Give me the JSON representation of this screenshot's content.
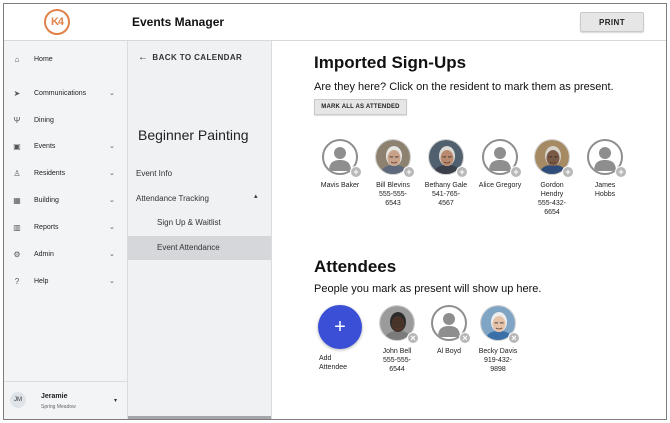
{
  "app": {
    "logo_text": "K4",
    "title": "Events Manager",
    "print_label": "PRINT"
  },
  "sidebar": {
    "items": [
      {
        "label": "Home",
        "icon": "home-icon",
        "glyph": "⌂",
        "has_chevron": false
      },
      {
        "label": "Communications",
        "icon": "send-icon",
        "glyph": "➤",
        "has_chevron": true
      },
      {
        "label": "Dining",
        "icon": "utensils-icon",
        "glyph": "Ψ",
        "has_chevron": false
      },
      {
        "label": "Events",
        "icon": "calendar-icon",
        "glyph": "▣",
        "has_chevron": true
      },
      {
        "label": "Residents",
        "icon": "person-icon",
        "glyph": "♙",
        "has_chevron": true
      },
      {
        "label": "Building",
        "icon": "building-icon",
        "glyph": "▦",
        "has_chevron": true
      },
      {
        "label": "Reports",
        "icon": "chart-icon",
        "glyph": "▥",
        "has_chevron": true
      },
      {
        "label": "Admin",
        "icon": "gear-icon",
        "glyph": "⚙",
        "has_chevron": true
      },
      {
        "label": "Help",
        "icon": "help-icon",
        "glyph": "?",
        "has_chevron": true
      }
    ],
    "user": {
      "initials": "JM",
      "name": "Jeramie",
      "org": "Spring Meadow"
    }
  },
  "subpanel": {
    "back_label": "BACK TO CALENDAR",
    "event_title": "Beginner Painting",
    "event_info": "Event Info",
    "attendance_tracking": "Attendance Tracking",
    "signup_waitlist": "Sign Up & Waitlist",
    "event_attendance": "Event Attendance"
  },
  "signups": {
    "title": "Imported Sign-Ups",
    "subtitle": "Are they here? Click on the resident to mark them as present.",
    "mark_all_label": "MARK ALL AS ATTENDED",
    "people": [
      {
        "name": "Mavis Baker",
        "lines": [
          "Mavis Baker"
        ],
        "photo": false,
        "bg": "#ffffff"
      },
      {
        "name": "Bill Blevins",
        "lines": [
          "Bill Blevins",
          "555-555-",
          "6543"
        ],
        "photo": true,
        "bg": "#8d8270",
        "skin": "#c9a28a",
        "hair": "#e8e6e2",
        "shirt": "#5e6a7c"
      },
      {
        "name": "Bethany Gale",
        "lines": [
          "Bethany Gale",
          "541-765-",
          "4567"
        ],
        "photo": true,
        "bg": "#50606e",
        "skin": "#b98a6d",
        "hair": "#dcdad6",
        "shirt": "#3b3f4a"
      },
      {
        "name": "Alice Gregory",
        "lines": [
          "Alice Gregory"
        ],
        "photo": false,
        "bg": "#ffffff"
      },
      {
        "name": "Gordon Hendry",
        "lines": [
          "Gordon",
          "Hendry",
          "555-432-",
          "6654"
        ],
        "photo": true,
        "bg": "#a58a63",
        "skin": "#7a5a45",
        "hair": "#d7d2ca",
        "shirt": "#2f4c7a"
      },
      {
        "name": "James Hobbs",
        "lines": [
          "James",
          "Hobbs"
        ],
        "photo": false,
        "bg": "#ffffff"
      }
    ]
  },
  "attendees": {
    "title": "Attendees",
    "subtitle": "People you mark as present will show up here.",
    "add_label": [
      "Add",
      "Attendee"
    ],
    "people": [
      {
        "name": "John Bell",
        "lines": [
          "John Bell",
          "555-555-",
          "6544"
        ],
        "photo": true,
        "bg": "#9b9b9b",
        "skin": "#4a3428",
        "hair": "#2b2b2b",
        "shirt": "#7b7b7b"
      },
      {
        "name": "Al Boyd",
        "lines": [
          "Al Boyd"
        ],
        "photo": false,
        "bg": "#ffffff"
      },
      {
        "name": "Becky Davis",
        "lines": [
          "Becky Davis",
          "919-432-",
          "9898"
        ],
        "photo": true,
        "bg": "#7fa4c4",
        "skin": "#e4c2a8",
        "hair": "#eeeeee",
        "shirt": "#3a6fa8"
      }
    ]
  }
}
